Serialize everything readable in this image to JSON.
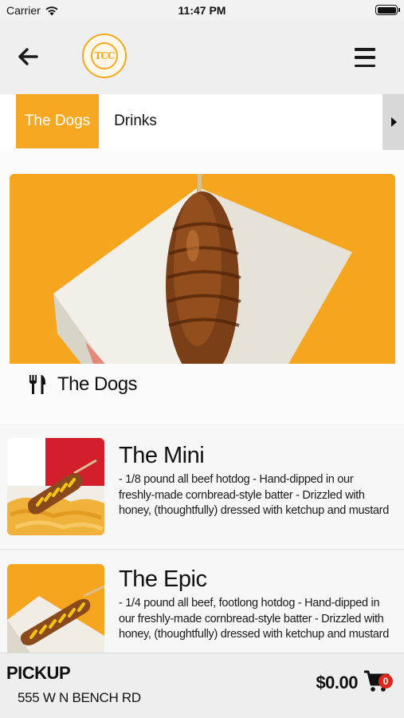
{
  "status_bar": {
    "carrier": "Carrier",
    "time": "11:47 PM"
  },
  "header": {
    "logo_text": "TCC"
  },
  "categories": {
    "tabs": [
      {
        "label": "The Dogs",
        "active": true
      },
      {
        "label": "Drinks",
        "active": false
      }
    ]
  },
  "hero": {
    "title": "The Dogs"
  },
  "items": [
    {
      "name": "The Mini",
      "description": "- 1/8 pound all beef hotdog - Hand-dipped in our freshly-made cornbread-style batter - Drizzled with honey, (thoughtfully) dressed with ketchup and mustard"
    },
    {
      "name": "The Epic",
      "description": "- 1/4 pound all beef, footlong hotdog - Hand-dipped in our freshly-made cornbread-style batter - Drizzled with honey, (thoughtfully) dressed with ketchup and mustard"
    }
  ],
  "footer": {
    "pickup_label": "PICKUP",
    "address": "555 W N BENCH RD",
    "total": "$0.00",
    "cart_count": "0"
  },
  "colors": {
    "accent": "#f7a823",
    "badge": "#e0251b"
  }
}
